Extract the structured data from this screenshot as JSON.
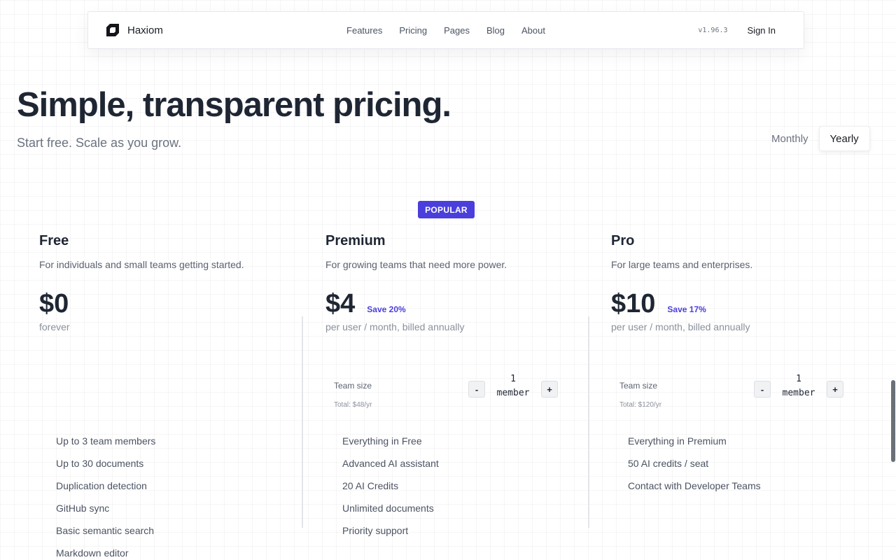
{
  "navbar": {
    "brand": "Haxiom",
    "links": [
      "Features",
      "Pricing",
      "Pages",
      "Blog",
      "About"
    ],
    "version": "v1.96.3",
    "signin_label": "Sign In"
  },
  "hero": {
    "title": "Simple, transparent pricing.",
    "subtitle": "Start free. Scale as you grow."
  },
  "billing": {
    "options": [
      "Monthly",
      "Yearly"
    ],
    "selected": "Yearly"
  },
  "popular_badge": "POPULAR",
  "plans": [
    {
      "name": "Free",
      "description": "For individuals and small teams getting started.",
      "price": "$0",
      "price_note": "forever",
      "features": [
        "Up to 3 team members",
        "Up to 30 documents",
        "Duplication detection",
        "GitHub sync",
        "Basic semantic search",
        "Markdown editor"
      ]
    },
    {
      "name": "Premium",
      "description": "For growing teams that need more power.",
      "price": "$4",
      "save": "Save 20%",
      "price_note": "per user / month, billed annually",
      "team_label": "Team size",
      "team_value": "1",
      "team_unit": "member",
      "team_total": "Total: $48/yr",
      "features": [
        "Everything in Free",
        "Advanced AI assistant",
        "20 AI Credits",
        "Unlimited documents",
        "Priority support"
      ]
    },
    {
      "name": "Pro",
      "description": "For large teams and enterprises.",
      "price": "$10",
      "save": "Save 17%",
      "price_note": "per user / month, billed annually",
      "team_label": "Team size",
      "team_value": "1",
      "team_unit": "member",
      "team_total": "Total: $120/yr",
      "features": [
        "Everything in Premium",
        "50 AI credits / seat",
        "Contact with Developer Teams"
      ]
    }
  ],
  "stepper": {
    "minus": "-",
    "plus": "+"
  },
  "colors": {
    "accent": "#4a3fdc",
    "text": "#1f2633",
    "muted": "#6b7280"
  },
  "icons": {
    "brand": "haxiom-logo-icon"
  }
}
